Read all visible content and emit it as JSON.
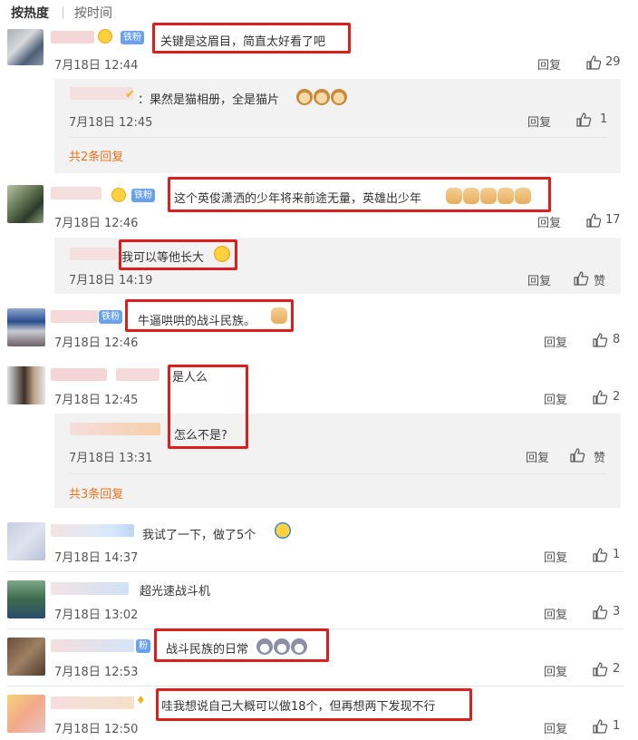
{
  "tabs": {
    "hot": "按热度",
    "time": "按时间"
  },
  "badges": {
    "tiefen": "铁粉",
    "fen": "粉"
  },
  "comments": [
    {
      "text": "关键是这眉目，简直太好看了吧",
      "time": "7月18日 12:44",
      "reply": "回复",
      "likes": "29"
    },
    {
      "text": "这个英俊潇洒的少年将来前途无量，英雄出少年",
      "time": "7月18日 12:46",
      "reply": "回复",
      "likes": "17"
    },
    {
      "text": "牛逼哄哄的战斗民族。",
      "time": "7月18日 12:46",
      "reply": "回复",
      "likes": "8"
    },
    {
      "text": "是人么",
      "time": "7月18日 12:45",
      "reply": "回复",
      "likes": "2"
    },
    {
      "text": "我试了一下，做了5个",
      "time": "7月18日 14:37",
      "reply": "回复",
      "likes": "1"
    },
    {
      "text": "超光速战斗机",
      "time": "7月18日 13:02",
      "reply": "回复",
      "likes": "3"
    },
    {
      "text": "战斗民族的日常",
      "time": "7月18日 12:53",
      "reply": "回复",
      "likes": "2"
    },
    {
      "text": "哇我想说自己大概可以做18个，但再想两下发现不行",
      "time": "7月18日 12:50",
      "reply": "回复",
      "likes": "1"
    }
  ],
  "replies": [
    {
      "text": "：果然是猫相册，全是猫片",
      "time": "7月18日 12:45",
      "reply": "回复",
      "likes": "1"
    },
    {
      "text": "我可以等他长大",
      "time": "7月18日 14:19",
      "reply": "回复",
      "likes": "赞"
    },
    {
      "text": "怎么不是?",
      "time": "7月18日 13:31",
      "reply": "回复",
      "likes": "赞"
    }
  ],
  "more": [
    "共2条回复",
    "共3条回复"
  ],
  "colors": {
    "accent_orange": "#e8731f",
    "highlight_red": "#d9201e",
    "badge_blue": "#6aa1ee"
  }
}
